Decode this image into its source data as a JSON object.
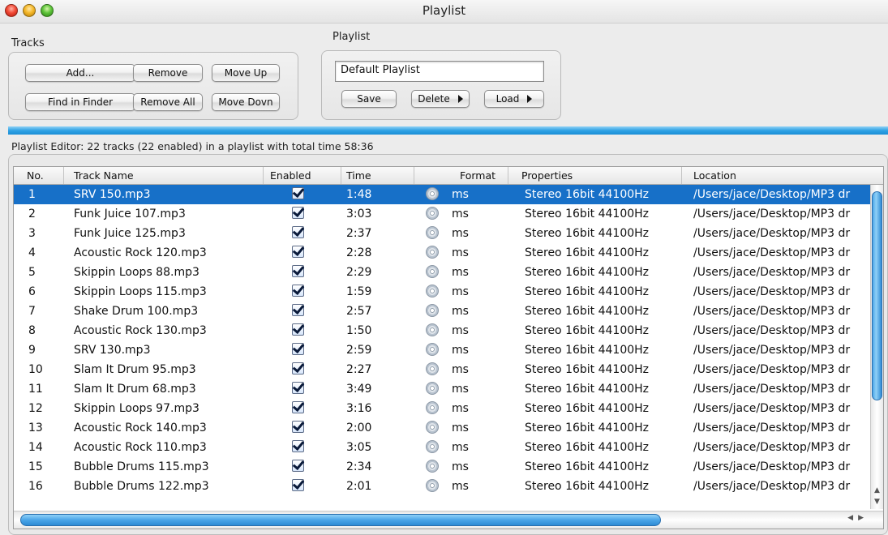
{
  "window": {
    "title": "Playlist"
  },
  "tracks_group": {
    "label": "Tracks",
    "buttons": {
      "add": "Add...",
      "remove": "Remove",
      "move_up": "Move Up",
      "find_in_finder": "Find in Finder",
      "remove_all": "Remove All",
      "move_down": "Move Dovn"
    }
  },
  "playlist_group": {
    "label": "Playlist",
    "name_value": "Default Playlist",
    "buttons": {
      "save": "Save",
      "delete": "Delete",
      "load": "Load"
    }
  },
  "status_text": "Playlist Editor: 22 tracks (22 enabled) in a playlist with total time 58:36",
  "table": {
    "columns": [
      "No.",
      "Track Name",
      "Enabled",
      "Time",
      "Format",
      "Properties",
      "Location"
    ],
    "rows": [
      {
        "no": "1",
        "name": "SRV 150.mp3",
        "enabled": true,
        "time": "1:48",
        "format": "ms",
        "properties": "Stereo 16bit 44100Hz",
        "location": "/Users/jace/Desktop/MP3 dr"
      },
      {
        "no": "2",
        "name": "Funk Juice 107.mp3",
        "enabled": true,
        "time": "3:03",
        "format": "ms",
        "properties": "Stereo 16bit 44100Hz",
        "location": "/Users/jace/Desktop/MP3 dr"
      },
      {
        "no": "3",
        "name": "Funk Juice 125.mp3",
        "enabled": true,
        "time": "2:37",
        "format": "ms",
        "properties": "Stereo 16bit 44100Hz",
        "location": "/Users/jace/Desktop/MP3 dr"
      },
      {
        "no": "4",
        "name": "Acoustic Rock 120.mp3",
        "enabled": true,
        "time": "2:28",
        "format": "ms",
        "properties": "Stereo 16bit 44100Hz",
        "location": "/Users/jace/Desktop/MP3 dr"
      },
      {
        "no": "5",
        "name": "Skippin Loops 88.mp3",
        "enabled": true,
        "time": "2:29",
        "format": "ms",
        "properties": "Stereo 16bit 44100Hz",
        "location": "/Users/jace/Desktop/MP3 dr"
      },
      {
        "no": "6",
        "name": "Skippin Loops 115.mp3",
        "enabled": true,
        "time": "1:59",
        "format": "ms",
        "properties": "Stereo 16bit 44100Hz",
        "location": "/Users/jace/Desktop/MP3 dr"
      },
      {
        "no": "7",
        "name": "Shake Drum 100.mp3",
        "enabled": true,
        "time": "2:57",
        "format": "ms",
        "properties": "Stereo 16bit 44100Hz",
        "location": "/Users/jace/Desktop/MP3 dr"
      },
      {
        "no": "8",
        "name": "Acoustic Rock 130.mp3",
        "enabled": true,
        "time": "1:50",
        "format": "ms",
        "properties": "Stereo 16bit 44100Hz",
        "location": "/Users/jace/Desktop/MP3 dr"
      },
      {
        "no": "9",
        "name": "SRV 130.mp3",
        "enabled": true,
        "time": "2:59",
        "format": "ms",
        "properties": "Stereo 16bit 44100Hz",
        "location": "/Users/jace/Desktop/MP3 dr"
      },
      {
        "no": "10",
        "name": "Slam It Drum 95.mp3",
        "enabled": true,
        "time": "2:27",
        "format": "ms",
        "properties": "Stereo 16bit 44100Hz",
        "location": "/Users/jace/Desktop/MP3 dr"
      },
      {
        "no": "11",
        "name": "Slam It Drum 68.mp3",
        "enabled": true,
        "time": "3:49",
        "format": "ms",
        "properties": "Stereo 16bit 44100Hz",
        "location": "/Users/jace/Desktop/MP3 dr"
      },
      {
        "no": "12",
        "name": "Skippin Loops 97.mp3",
        "enabled": true,
        "time": "3:16",
        "format": "ms",
        "properties": "Stereo 16bit 44100Hz",
        "location": "/Users/jace/Desktop/MP3 dr"
      },
      {
        "no": "13",
        "name": "Acoustic Rock 140.mp3",
        "enabled": true,
        "time": "2:00",
        "format": "ms",
        "properties": "Stereo 16bit 44100Hz",
        "location": "/Users/jace/Desktop/MP3 dr"
      },
      {
        "no": "14",
        "name": "Acoustic Rock 110.mp3",
        "enabled": true,
        "time": "3:05",
        "format": "ms",
        "properties": "Stereo 16bit 44100Hz",
        "location": "/Users/jace/Desktop/MP3 dr"
      },
      {
        "no": "15",
        "name": "Bubble Drums 115.mp3",
        "enabled": true,
        "time": "2:34",
        "format": "ms",
        "properties": "Stereo 16bit 44100Hz",
        "location": "/Users/jace/Desktop/MP3 dr"
      },
      {
        "no": "16",
        "name": "Bubble Drums 122.mp3",
        "enabled": true,
        "time": "2:01",
        "format": "ms",
        "properties": "Stereo 16bit 44100Hz",
        "location": "/Users/jace/Desktop/MP3 dr"
      }
    ],
    "selected_row": 0
  },
  "icons": {
    "format_icon": "cd-icon",
    "enabled_icon": "checkbox-checked-icon"
  },
  "colors": {
    "selection": "#1770c8",
    "aqua_blue": "#2fa2e4"
  }
}
